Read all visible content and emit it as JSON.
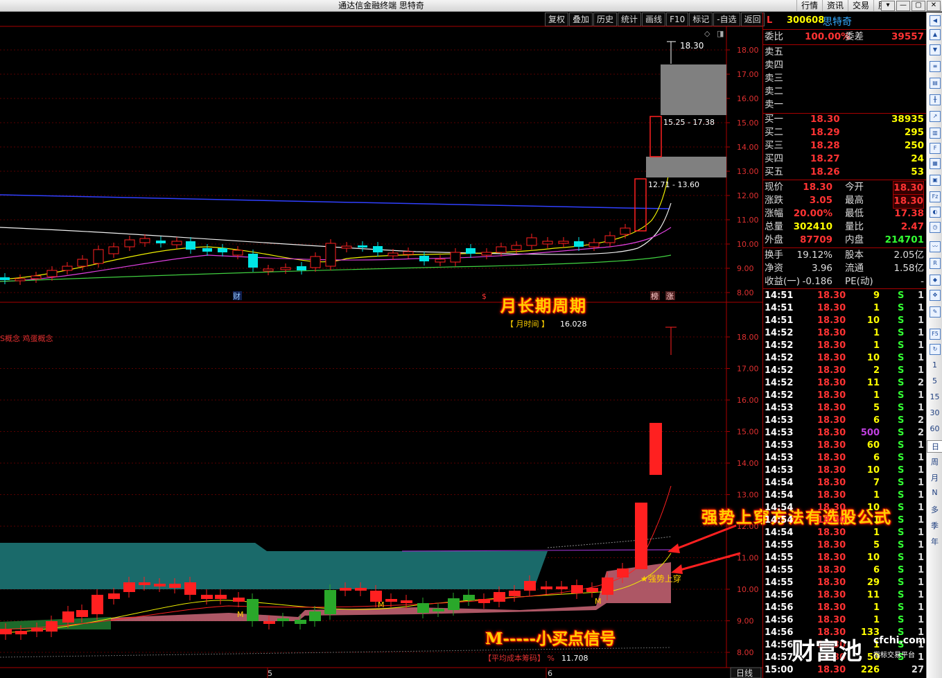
{
  "window": {
    "title": "通达信金融终端  思特奇",
    "menu": [
      "行情",
      "资讯",
      "交易",
      "服务"
    ],
    "buttons": [
      "▾",
      "—",
      "▢",
      "✕"
    ]
  },
  "toolbar": [
    "复权",
    "叠加",
    "历史",
    "统计",
    "画线",
    "F10",
    "标记",
    "-自选",
    "返回"
  ],
  "stock": {
    "flag": "L",
    "code": "300608",
    "name": "思特奇"
  },
  "colors": {
    "up": "#ff2020",
    "down": "#00e5e5",
    "vol_up": "#ff2020",
    "vol_down": "#2aa82a",
    "ma_white": "#f0f0f0",
    "ma_yellow": "#f0f000",
    "ma_magenta": "#e040e0",
    "ma_green": "#40d040",
    "ma_blue": "#3040ff",
    "teal_band": "#1a6a6a",
    "pink_band": "#c06070"
  },
  "main_chart": {
    "price_axis": [
      "18.00",
      "17.00",
      "16.00",
      "15.00",
      "14.00",
      "13.00",
      "12.00",
      "11.00",
      "10.00",
      "9.00",
      "8.00"
    ],
    "peak_label": "18.30",
    "box_upper_label": "15.25 - 17.38",
    "box_lower_label": "12.71 - 13.60",
    "markers": [
      "财",
      "$",
      "榜",
      "涨"
    ]
  },
  "sub_chart": {
    "price_axis": [
      "18.00",
      "17.00",
      "16.00",
      "15.00",
      "14.00",
      "13.00",
      "12.00",
      "11.00",
      "10.00",
      "9.00",
      "8.00"
    ],
    "concept_text": "S概念 鸡蛋概念",
    "time_label": "【 月时间 】",
    "time_value": "16.028",
    "signal_label": "★强势上穿",
    "m_marks": [
      "M",
      "M",
      "M"
    ],
    "cost_label": "【平均成本筹码】 %",
    "cost_value": "11.708",
    "date_marks": [
      "5",
      "6"
    ],
    "period_label": "日线"
  },
  "annotations": {
    "title": "月长期周期",
    "formula": "强势上穿方法有选股公式",
    "signal": "M-----小买点信号"
  },
  "quote": {
    "weibi_label": "委比",
    "weibi": "100.00%",
    "weicha_label": "委差",
    "weicha": "39557",
    "sells": [
      {
        "label": "卖五"
      },
      {
        "label": "卖四"
      },
      {
        "label": "卖三"
      },
      {
        "label": "卖二"
      },
      {
        "label": "卖一"
      }
    ],
    "buys": [
      {
        "label": "买一",
        "price": "18.30",
        "vol": "38935"
      },
      {
        "label": "买二",
        "price": "18.29",
        "vol": "295"
      },
      {
        "label": "买三",
        "price": "18.28",
        "vol": "250"
      },
      {
        "label": "买四",
        "price": "18.27",
        "vol": "24"
      },
      {
        "label": "买五",
        "price": "18.26",
        "vol": "53"
      }
    ],
    "stats": [
      {
        "l1": "现价",
        "v1": "18.30",
        "l2": "今开",
        "v2": "18.30"
      },
      {
        "l1": "涨跌",
        "v1": "3.05",
        "l2": "最高",
        "v2": "18.30"
      },
      {
        "l1": "涨幅",
        "v1": "20.00%",
        "l2": "最低",
        "v2": "17.38"
      },
      {
        "l1": "总量",
        "v1": "302410",
        "l2": "量比",
        "v2": "2.47"
      },
      {
        "l1": "外盘",
        "v1": "87709",
        "l2": "内盘",
        "v2": "214701"
      }
    ],
    "stats2": [
      {
        "l1": "换手",
        "v1": "19.12%",
        "l2": "股本",
        "v2": "2.05亿"
      },
      {
        "l1": "净资",
        "v1": "3.96",
        "l2": "流通",
        "v2": "1.58亿"
      },
      {
        "l1": "收益(一)",
        "v1": "-0.186",
        "l2": "PE(动)",
        "v2": "-"
      }
    ]
  },
  "ticks": [
    {
      "t": "14:51",
      "p": "18.30",
      "v": "9",
      "s": "S",
      "n": "1"
    },
    {
      "t": "14:51",
      "p": "18.30",
      "v": "1",
      "s": "S",
      "n": "1"
    },
    {
      "t": "14:51",
      "p": "18.30",
      "v": "10",
      "s": "S",
      "n": "1"
    },
    {
      "t": "14:52",
      "p": "18.30",
      "v": "1",
      "s": "S",
      "n": "1"
    },
    {
      "t": "14:52",
      "p": "18.30",
      "v": "1",
      "s": "S",
      "n": "1"
    },
    {
      "t": "14:52",
      "p": "18.30",
      "v": "10",
      "s": "S",
      "n": "1"
    },
    {
      "t": "14:52",
      "p": "18.30",
      "v": "2",
      "s": "S",
      "n": "1"
    },
    {
      "t": "14:52",
      "p": "18.30",
      "v": "11",
      "s": "S",
      "n": "2"
    },
    {
      "t": "14:52",
      "p": "18.30",
      "v": "1",
      "s": "S",
      "n": "1"
    },
    {
      "t": "14:53",
      "p": "18.30",
      "v": "5",
      "s": "S",
      "n": "1"
    },
    {
      "t": "14:53",
      "p": "18.30",
      "v": "6",
      "s": "S",
      "n": "2"
    },
    {
      "t": "14:53",
      "p": "18.30",
      "v": "500",
      "s": "S",
      "n": "2"
    },
    {
      "t": "14:53",
      "p": "18.30",
      "v": "60",
      "s": "S",
      "n": "1"
    },
    {
      "t": "14:53",
      "p": "18.30",
      "v": "6",
      "s": "S",
      "n": "1"
    },
    {
      "t": "14:53",
      "p": "18.30",
      "v": "10",
      "s": "S",
      "n": "1"
    },
    {
      "t": "14:54",
      "p": "18.30",
      "v": "7",
      "s": "S",
      "n": "1"
    },
    {
      "t": "14:54",
      "p": "18.30",
      "v": "1",
      "s": "S",
      "n": "1"
    },
    {
      "t": "14:54",
      "p": "18.30",
      "v": "10",
      "s": "S",
      "n": "1"
    },
    {
      "t": "14:54",
      "p": "18.30",
      "v": "1",
      "s": "S",
      "n": "1"
    },
    {
      "t": "14:54",
      "p": "18.30",
      "v": "1",
      "s": "S",
      "n": "1"
    },
    {
      "t": "14:55",
      "p": "18.30",
      "v": "5",
      "s": "S",
      "n": "1"
    },
    {
      "t": "14:55",
      "p": "18.30",
      "v": "10",
      "s": "S",
      "n": "1"
    },
    {
      "t": "14:55",
      "p": "18.30",
      "v": "6",
      "s": "S",
      "n": "1"
    },
    {
      "t": "14:55",
      "p": "18.30",
      "v": "29",
      "s": "S",
      "n": "1"
    },
    {
      "t": "14:56",
      "p": "18.30",
      "v": "11",
      "s": "S",
      "n": "1"
    },
    {
      "t": "14:56",
      "p": "18.30",
      "v": "1",
      "s": "S",
      "n": "1"
    },
    {
      "t": "14:56",
      "p": "18.30",
      "v": "1",
      "s": "S",
      "n": "1"
    },
    {
      "t": "14:56",
      "p": "18.30",
      "v": "133",
      "s": "S",
      "n": "1"
    },
    {
      "t": "14:56",
      "p": "18.30",
      "v": "1",
      "s": "S",
      "n": "1"
    },
    {
      "t": "14:57",
      "p": "18.30",
      "v": "50",
      "s": "S",
      "n": "1"
    },
    {
      "t": "15:00",
      "p": "18.30",
      "v": "226",
      "s": "",
      "n": "27"
    }
  ],
  "sidebar_periods": [
    "1",
    "5",
    "15",
    "30",
    "60",
    "日",
    "周",
    "月",
    "N",
    "多",
    "季",
    "年"
  ],
  "watermark": {
    "big": "财富池",
    "site": "cfchi.com",
    "sub": "指标交易平台"
  }
}
